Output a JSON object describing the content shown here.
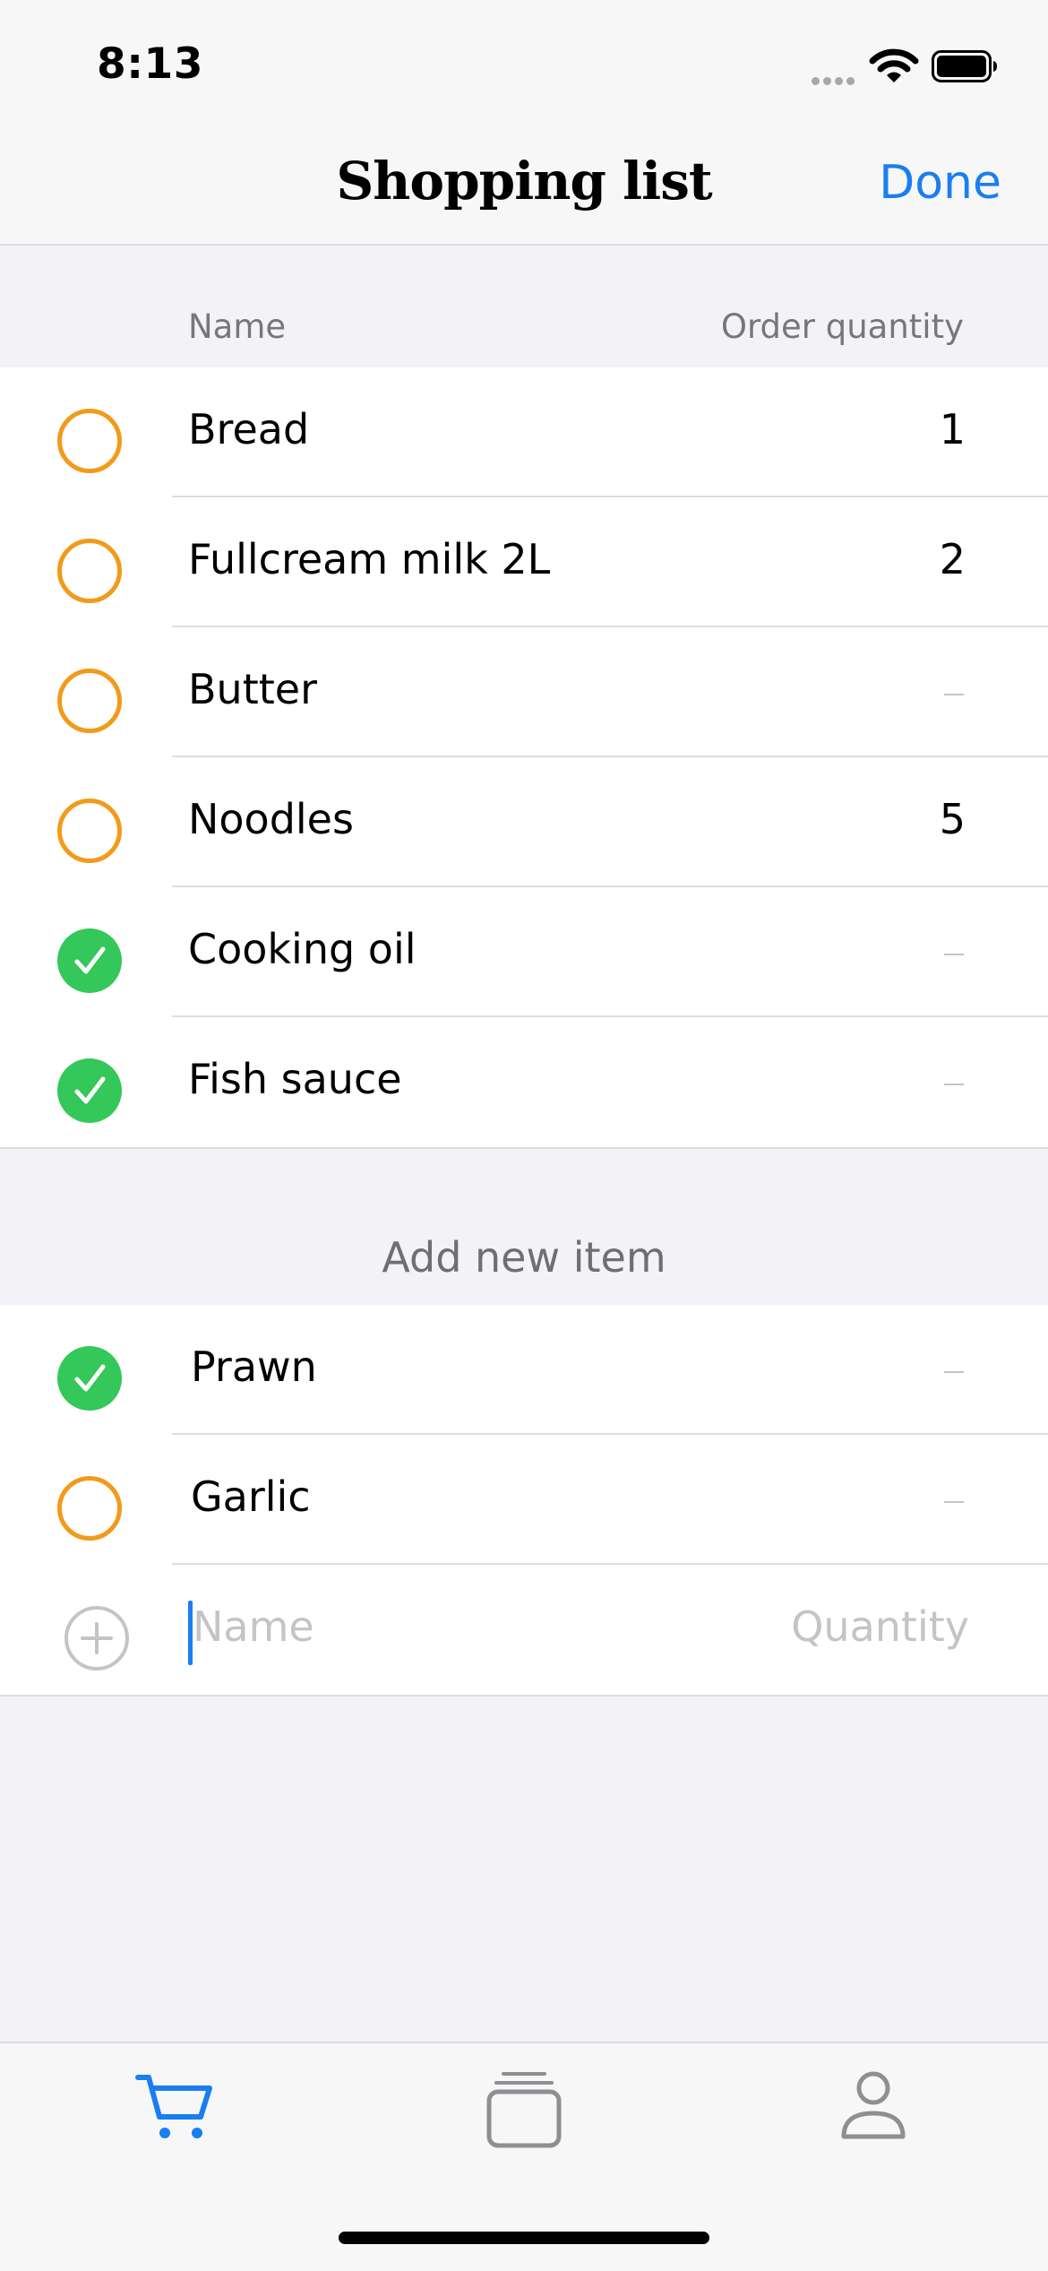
{
  "status_bar": {
    "time": "8:13"
  },
  "nav": {
    "title": "Shopping list",
    "done_label": "Done"
  },
  "list_header": {
    "name_col": "Name",
    "quantity_col": "Order quantity"
  },
  "items": [
    {
      "name": "Bread",
      "quantity": "1",
      "checked": false
    },
    {
      "name": "Fullcream milk 2L",
      "quantity": "2",
      "checked": false
    },
    {
      "name": "Butter",
      "quantity": "",
      "checked": false
    },
    {
      "name": "Noodles",
      "quantity": "5",
      "checked": false
    },
    {
      "name": "Cooking oil",
      "quantity": "",
      "checked": true
    },
    {
      "name": "Fish sauce",
      "quantity": "",
      "checked": true
    }
  ],
  "add_section": {
    "title": "Add new item",
    "items": [
      {
        "name": "Prawn",
        "quantity": "",
        "checked": true
      },
      {
        "name": "Garlic",
        "quantity": "",
        "checked": false
      }
    ],
    "name_placeholder": "Name",
    "quantity_placeholder": "Quantity"
  },
  "tabs": [
    {
      "icon": "cart-icon",
      "active": true
    },
    {
      "icon": "stack-icon",
      "active": false
    },
    {
      "icon": "person-icon",
      "active": false
    }
  ],
  "colors": {
    "accent": "#1a7ef2",
    "unchecked": "#f39a1b",
    "checked": "#34c759"
  }
}
